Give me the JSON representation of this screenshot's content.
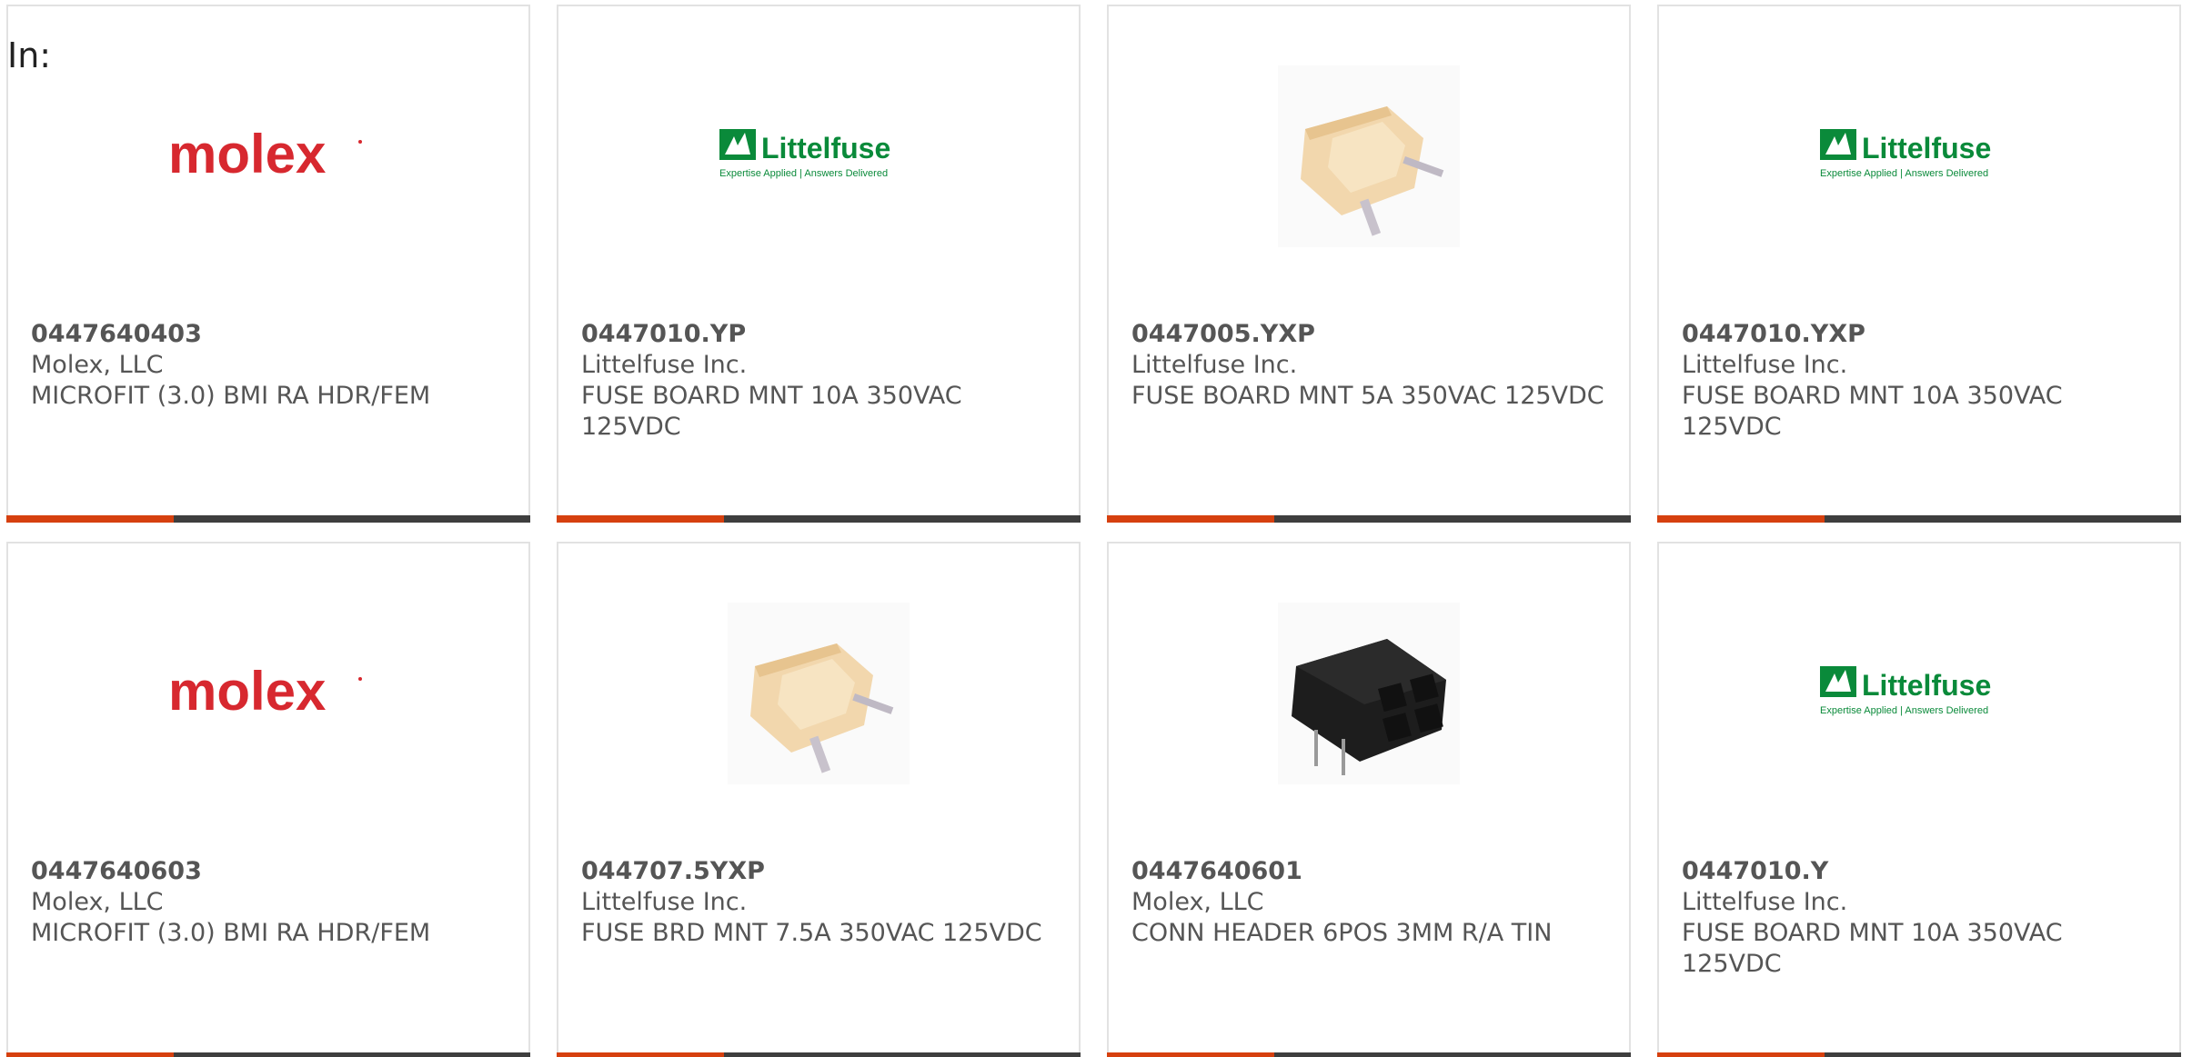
{
  "filter_label": "In:",
  "colors": {
    "accent": "#d6400f",
    "bar": "#3e3e3e",
    "molex_red": "#d7282f",
    "littelfuse_green": "#0a8a3a"
  },
  "cards": [
    {
      "part_number": "0447640403",
      "manufacturer": "Molex, LLC",
      "description": "MICROFIT (3.0) BMI RA HDR/FEM",
      "image": "molex-logo",
      "logo_text": "molex"
    },
    {
      "part_number": "0447010.YP",
      "manufacturer": "Littelfuse Inc.",
      "description": "FUSE BOARD MNT 10A 350VAC 125VDC",
      "image": "littelfuse-logo",
      "logo_text": "Littelfuse",
      "logo_tagline": "Expertise Applied | Answers Delivered"
    },
    {
      "part_number": "0447005.YXP",
      "manufacturer": "Littelfuse Inc.",
      "description": "FUSE BOARD MNT 5A 350VAC 125VDC",
      "image": "fuse-photo"
    },
    {
      "part_number": "0447010.YXP",
      "manufacturer": "Littelfuse Inc.",
      "description": "FUSE BOARD MNT 10A 350VAC 125VDC",
      "image": "littelfuse-logo",
      "logo_text": "Littelfuse",
      "logo_tagline": "Expertise Applied | Answers Delivered"
    },
    {
      "part_number": "0447640603",
      "manufacturer": "Molex, LLC",
      "description": "MICROFIT (3.0) BMI RA HDR/FEM",
      "image": "molex-logo",
      "logo_text": "molex"
    },
    {
      "part_number": "044707.5YXP",
      "manufacturer": "Littelfuse Inc.",
      "description": "FUSE BRD MNT 7.5A 350VAC 125VDC",
      "image": "fuse-photo"
    },
    {
      "part_number": "0447640601",
      "manufacturer": "Molex, LLC",
      "description": "CONN HEADER 6POS 3MM R/A TIN",
      "image": "connector-photo"
    },
    {
      "part_number": "0447010.Y",
      "manufacturer": "Littelfuse Inc.",
      "description": "FUSE BOARD MNT 10A 350VAC 125VDC",
      "image": "littelfuse-logo",
      "logo_text": "Littelfuse",
      "logo_tagline": "Expertise Applied | Answers Delivered"
    }
  ]
}
